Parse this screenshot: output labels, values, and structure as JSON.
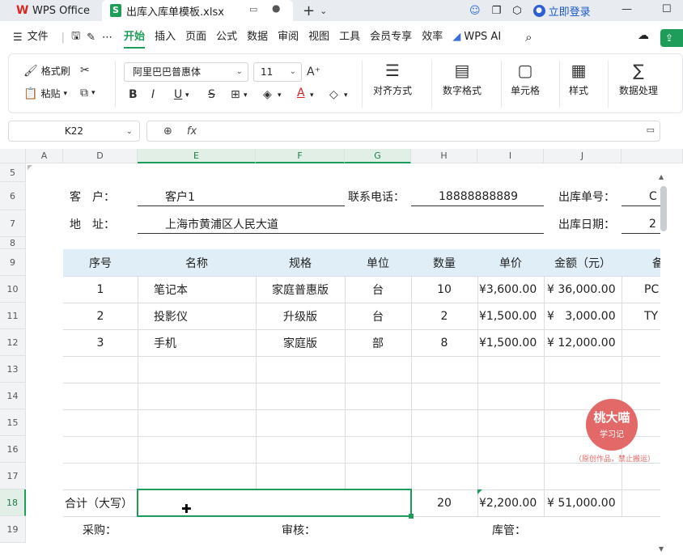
{
  "titlebar": {
    "app_tab": "WPS Office",
    "file_tab": "出库入库单模板.xlsx",
    "login": "立即登录"
  },
  "menu": {
    "file": "文件",
    "items": [
      "开始",
      "插入",
      "页面",
      "公式",
      "数据",
      "审阅",
      "视图",
      "工具",
      "会员专享",
      "效率"
    ],
    "wps_ai": "WPS AI"
  },
  "ribbon": {
    "format_painter": "格式刷",
    "paste": "粘贴",
    "font_name": "阿里巴巴普惠体",
    "font_size": "11",
    "align": "对齐方式",
    "number_format": "数字格式",
    "cell": "单元格",
    "style": "样式",
    "data_process": "数据处理"
  },
  "formula": {
    "namebox": "K22",
    "fx": "fx",
    "value": ""
  },
  "grid": {
    "columns": [
      "A",
      "D",
      "E",
      "F",
      "G",
      "H",
      "I",
      "J"
    ],
    "rows": [
      "5",
      "6",
      "7",
      "8",
      "9",
      "10",
      "11",
      "12",
      "13",
      "14",
      "15",
      "16",
      "17",
      "18",
      "19"
    ],
    "info": {
      "customer_label": "客　户：",
      "customer_value": "客户1",
      "phone_label": "联系电话：",
      "phone_value": "18888888889",
      "out_no_label": "出库单号：",
      "out_no_value": "C",
      "address_label": "地　址：",
      "address_value": "上海市黄浦区人民大道",
      "out_date_label": "出库日期：",
      "out_date_value": "2"
    },
    "table_header": [
      "序号",
      "名称",
      "规格",
      "单位",
      "数量",
      "单价",
      "金额（元）",
      "备"
    ],
    "table_rows": [
      [
        "1",
        "笔记本",
        "家庭普惠版",
        "台",
        "10",
        "¥3,600.00",
        "¥ 36,000.00",
        "PC"
      ],
      [
        "2",
        "投影仪",
        "升级版",
        "台",
        "2",
        "¥1,500.00",
        "¥   3,000.00",
        "TY"
      ],
      [
        "3",
        "手机",
        "家庭版",
        "部",
        "8",
        "¥1,500.00",
        "¥ 12,000.00",
        ""
      ]
    ],
    "total_label": "合计（大写）",
    "total_qty": "20",
    "total_price": "¥2,200.00",
    "total_amount": "¥ 51,000.00",
    "sign_purchase": "采购：",
    "sign_review": "审核：",
    "sign_keeper": "库管："
  },
  "watermark": {
    "name": "桃大喵",
    "sub": "学习记",
    "note": "（原创作品，禁止搬运）"
  }
}
